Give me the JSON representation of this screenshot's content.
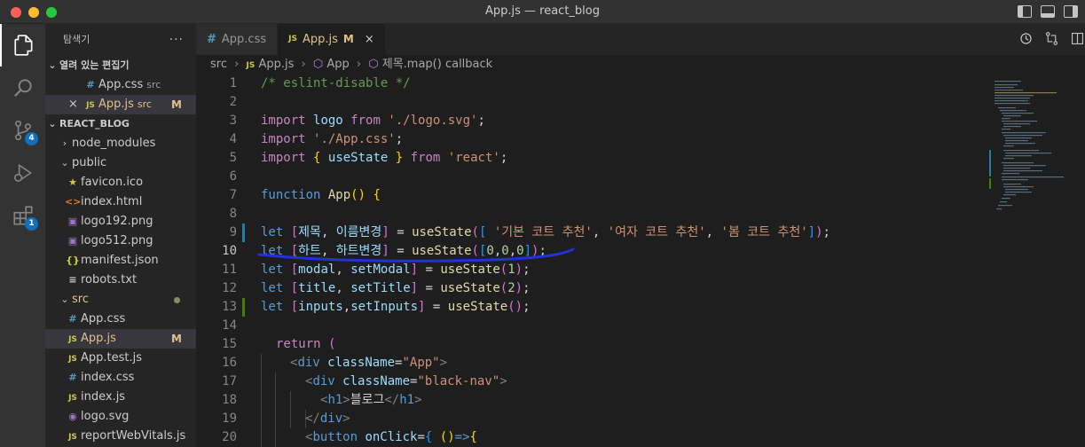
{
  "window": {
    "title": "App.js — react_blog"
  },
  "activity_bar": {
    "items": [
      {
        "name": "explorer",
        "icon": "files-icon"
      },
      {
        "name": "search",
        "icon": "search-icon"
      },
      {
        "name": "source-control",
        "icon": "source-control-icon",
        "badge": "4"
      },
      {
        "name": "run-debug",
        "icon": "run-debug-icon"
      },
      {
        "name": "extensions",
        "icon": "extensions-icon",
        "badge": "1"
      }
    ]
  },
  "sidebar": {
    "title": "탐색기",
    "more": "···",
    "open_editors": {
      "label": "열려 있는 편집기",
      "files": [
        {
          "icon": "#",
          "name": "App.css",
          "desc": "src",
          "status": ""
        },
        {
          "icon": "JS",
          "name": "App.js",
          "desc": "src",
          "status": "M"
        }
      ]
    },
    "project": {
      "label": "REACT_BLOG",
      "items": [
        {
          "type": "folder",
          "name": "node_modules",
          "expanded": false
        },
        {
          "type": "folder",
          "name": "public",
          "expanded": true
        },
        {
          "type": "file",
          "icon": "★",
          "name": "favicon.ico"
        },
        {
          "type": "file",
          "icon": "<>",
          "name": "index.html"
        },
        {
          "type": "file",
          "icon": "▣",
          "name": "logo192.png"
        },
        {
          "type": "file",
          "icon": "▣",
          "name": "logo512.png"
        },
        {
          "type": "file",
          "icon": "{}",
          "name": "manifest.json"
        },
        {
          "type": "file",
          "icon": "≡",
          "name": "robots.txt"
        },
        {
          "type": "folder",
          "name": "src",
          "expanded": true
        },
        {
          "type": "file",
          "icon": "#",
          "name": "App.css"
        },
        {
          "type": "file",
          "icon": "JS",
          "name": "App.js",
          "status": "M"
        },
        {
          "type": "file",
          "icon": "JS",
          "name": "App.test.js"
        },
        {
          "type": "file",
          "icon": "#",
          "name": "index.css"
        },
        {
          "type": "file",
          "icon": "JS",
          "name": "index.js"
        },
        {
          "type": "file",
          "icon": "◉",
          "name": "logo.svg"
        },
        {
          "type": "file",
          "icon": "JS",
          "name": "reportWebVitals.js"
        }
      ]
    }
  },
  "tabs": [
    {
      "icon": "#",
      "label": "App.css",
      "active": false,
      "status": ""
    },
    {
      "icon": "JS",
      "label": "App.js",
      "active": true,
      "status": "M",
      "close": "×"
    }
  ],
  "breadcrumb": {
    "parts": [
      "src",
      "App.js",
      "App",
      "제목.map() callback"
    ]
  },
  "code": {
    "current_line": 10,
    "lines": [
      {
        "n": "1"
      },
      {
        "n": "2"
      },
      {
        "n": "3"
      },
      {
        "n": "4"
      },
      {
        "n": "5"
      },
      {
        "n": "6"
      },
      {
        "n": "7"
      },
      {
        "n": "8"
      },
      {
        "n": "9"
      },
      {
        "n": "10"
      },
      {
        "n": "11"
      },
      {
        "n": "12"
      },
      {
        "n": "13"
      },
      {
        "n": "14"
      },
      {
        "n": "15"
      },
      {
        "n": "16"
      },
      {
        "n": "17"
      },
      {
        "n": "18"
      },
      {
        "n": "19"
      },
      {
        "n": "20"
      }
    ]
  },
  "colors": {
    "annotation_stroke": "#2132d8",
    "accent": "#0e70c0",
    "modified": "#e2c08d"
  }
}
